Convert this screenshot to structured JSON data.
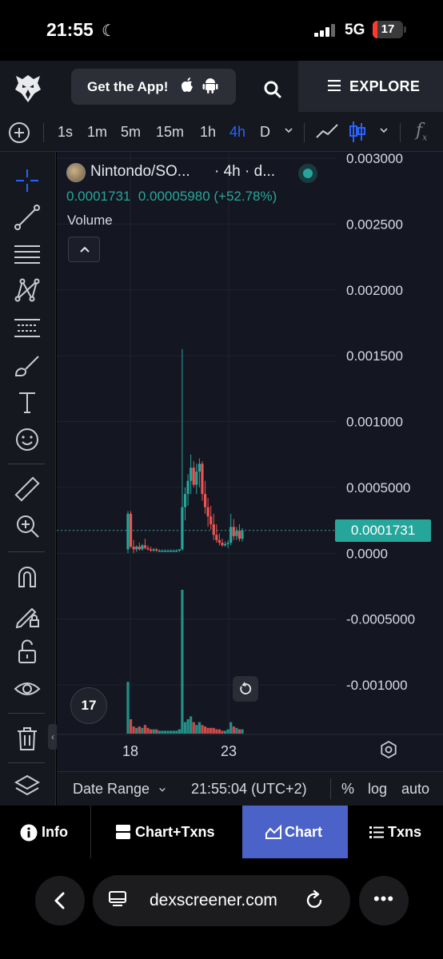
{
  "status_bar": {
    "time": "21:55",
    "network": "5G",
    "battery": "17",
    "battery_percent": 17
  },
  "header": {
    "get_app_label": "Get the App!",
    "explore_label": "EXPLORE"
  },
  "toolbar": {
    "timeframes": [
      "1s",
      "1m",
      "5m",
      "15m",
      "1h",
      "4h",
      "D"
    ],
    "active_timeframe": "4h"
  },
  "legend": {
    "pair": "Nintondo/SO...",
    "meta": "· 4h · d...",
    "open": "0.0001731",
    "change": "0.00005980 (+52.78%)",
    "volume_label": "Volume"
  },
  "price_axis": {
    "ticks": [
      "0.003000",
      "0.002500",
      "0.002000",
      "0.001500",
      "0.001000",
      "0.0005000",
      "0.0000",
      "-0.0005000",
      "-0.001000"
    ],
    "current_price": "0.0001731"
  },
  "time_axis": {
    "labels": [
      "18",
      "23"
    ]
  },
  "tv_logo_text": "17",
  "footer": {
    "date_range": "Date Range",
    "clock": "21:55:04 (UTC+2)",
    "percent": "%",
    "log": "log",
    "auto": "auto"
  },
  "tabs": [
    {
      "label": "Info",
      "icon": "info-icon"
    },
    {
      "label": "Chart+Txns",
      "icon": "split-view-icon"
    },
    {
      "label": "Chart",
      "icon": "area-chart-icon",
      "active": true
    },
    {
      "label": "Txns",
      "icon": "list-icon"
    }
  ],
  "browser": {
    "url": "dexscreener.com"
  },
  "colors": {
    "up": "#26a69a",
    "down": "#ef5350",
    "accent": "#2962ff",
    "active_tab": "#4b63c8"
  },
  "chart_data": {
    "type": "candlestick",
    "interval": "4h",
    "y_range": [
      -0.0012,
      0.003
    ],
    "x_labels": [
      "18",
      "23"
    ],
    "last_price": 0.0001731,
    "candles": [
      {
        "o": 3e-05,
        "h": 0.00032,
        "l": 0.0,
        "c": 0.0003
      },
      {
        "o": 0.0003,
        "h": 0.00032,
        "l": 4e-05,
        "c": 5e-05
      },
      {
        "o": 5e-05,
        "h": 0.0001,
        "l": 0.0,
        "c": 3e-05
      },
      {
        "o": 3e-05,
        "h": 6e-05,
        "l": 1e-05,
        "c": 5e-05
      },
      {
        "o": 5e-05,
        "h": 8e-05,
        "l": 2e-05,
        "c": 3e-05
      },
      {
        "o": 3e-05,
        "h": 7e-05,
        "l": 2e-05,
        "c": 6e-05
      },
      {
        "o": 6e-05,
        "h": 0.00011,
        "l": 3e-05,
        "c": 4e-05
      },
      {
        "o": 4e-05,
        "h": 6e-05,
        "l": 2e-05,
        "c": 3e-05
      },
      {
        "o": 3e-05,
        "h": 5e-05,
        "l": 1e-05,
        "c": 2e-05
      },
      {
        "o": 2e-05,
        "h": 4e-05,
        "l": 1e-05,
        "c": 3e-05
      },
      {
        "o": 3e-05,
        "h": 4e-05,
        "l": 1e-05,
        "c": 2e-05
      },
      {
        "o": 2e-05,
        "h": 3e-05,
        "l": 1e-05,
        "c": 2e-05
      },
      {
        "o": 2e-05,
        "h": 3e-05,
        "l": 1e-05,
        "c": 2e-05
      },
      {
        "o": 2e-05,
        "h": 3e-05,
        "l": 1e-05,
        "c": 2e-05
      },
      {
        "o": 2e-05,
        "h": 3e-05,
        "l": 1e-05,
        "c": 2e-05
      },
      {
        "o": 2e-05,
        "h": 3e-05,
        "l": 1e-05,
        "c": 2e-05
      },
      {
        "o": 2e-05,
        "h": 3e-05,
        "l": 1e-05,
        "c": 2e-05
      },
      {
        "o": 2e-05,
        "h": 3e-05,
        "l": 1e-05,
        "c": 2e-05
      },
      {
        "o": 2e-05,
        "h": 3e-05,
        "l": 1e-05,
        "c": 3e-05
      },
      {
        "o": 3e-05,
        "h": 0.00155,
        "l": 2e-05,
        "c": 0.00035
      },
      {
        "o": 0.00035,
        "h": 0.0005,
        "l": 0.00025,
        "c": 0.00045
      },
      {
        "o": 0.00045,
        "h": 0.0006,
        "l": 0.00036,
        "c": 0.00055
      },
      {
        "o": 0.00055,
        "h": 0.00075,
        "l": 0.00045,
        "c": 0.00065
      },
      {
        "o": 0.00065,
        "h": 0.0007,
        "l": 0.0005,
        "c": 0.00052
      },
      {
        "o": 0.00052,
        "h": 0.00068,
        "l": 0.00045,
        "c": 0.00062
      },
      {
        "o": 0.00062,
        "h": 0.00072,
        "l": 0.0005,
        "c": 0.00068
      },
      {
        "o": 0.00068,
        "h": 0.0007,
        "l": 0.0004,
        "c": 0.00045
      },
      {
        "o": 0.00045,
        "h": 0.00055,
        "l": 0.0003,
        "c": 0.00035
      },
      {
        "o": 0.00035,
        "h": 0.00042,
        "l": 0.0002,
        "c": 0.00028
      },
      {
        "o": 0.00028,
        "h": 0.00036,
        "l": 0.00018,
        "c": 0.00022
      },
      {
        "o": 0.00022,
        "h": 0.0003,
        "l": 0.0001,
        "c": 0.00014
      },
      {
        "o": 0.00014,
        "h": 0.00022,
        "l": 8e-05,
        "c": 0.0001
      },
      {
        "o": 0.0001,
        "h": 0.00015,
        "l": 6e-05,
        "c": 8e-05
      },
      {
        "o": 8e-05,
        "h": 0.00011,
        "l": 5e-05,
        "c": 6e-05
      },
      {
        "o": 6e-05,
        "h": 9e-05,
        "l": 5e-05,
        "c": 7e-05
      },
      {
        "o": 7e-05,
        "h": 0.0001,
        "l": 4e-05,
        "c": 8e-05
      },
      {
        "o": 8e-05,
        "h": 0.0003,
        "l": 6e-05,
        "c": 0.0002
      },
      {
        "o": 0.0002,
        "h": 0.00026,
        "l": 0.0001,
        "c": 0.00013
      },
      {
        "o": 0.00013,
        "h": 0.0002,
        "l": 0.0001,
        "c": 0.00017
      },
      {
        "o": 0.00017,
        "h": 0.00022,
        "l": 9e-05,
        "c": 0.00011
      },
      {
        "o": 0.00011,
        "h": 0.00019,
        "l": 9e-05,
        "c": 0.0001731
      }
    ],
    "volumes": [
      0.36,
      0.1,
      0.05,
      0.04,
      0.05,
      0.04,
      0.06,
      0.04,
      0.03,
      0.03,
      0.03,
      0.02,
      0.02,
      0.02,
      0.02,
      0.02,
      0.02,
      0.02,
      0.03,
      1.0,
      0.08,
      0.1,
      0.12,
      0.08,
      0.06,
      0.08,
      0.06,
      0.05,
      0.04,
      0.04,
      0.04,
      0.03,
      0.03,
      0.02,
      0.02,
      0.03,
      0.08,
      0.05,
      0.04,
      0.03,
      0.03
    ]
  }
}
